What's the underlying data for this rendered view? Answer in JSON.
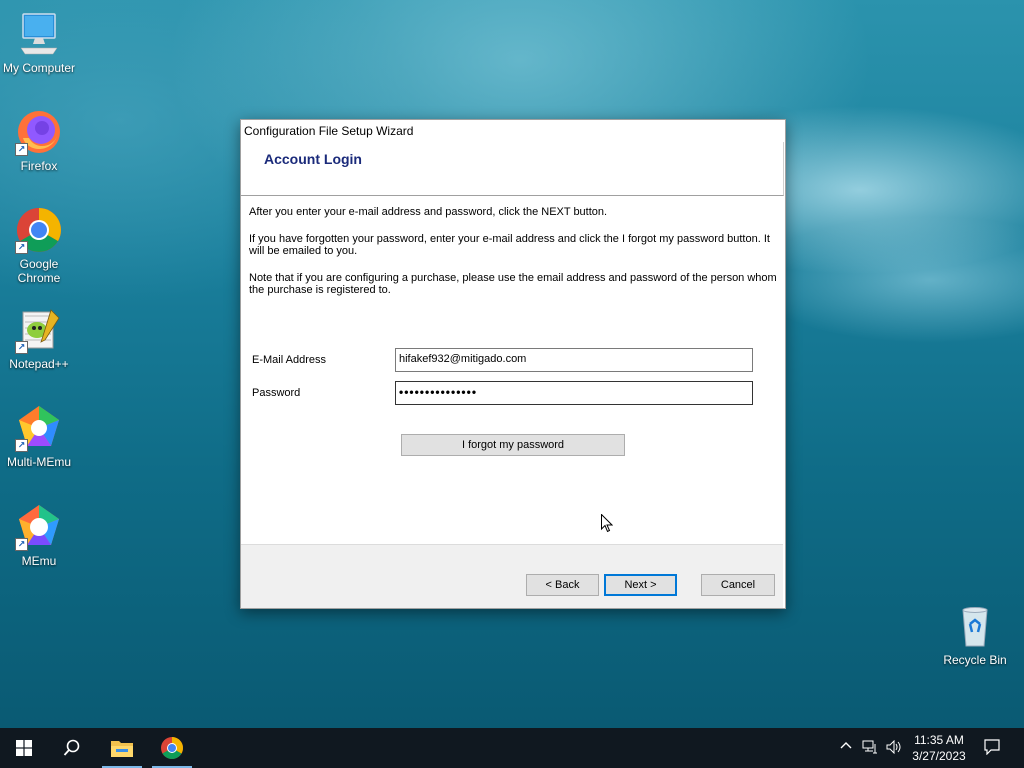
{
  "desktop": {
    "icons": [
      {
        "label": "My Computer"
      },
      {
        "label": "Firefox"
      },
      {
        "label": "Google Chrome"
      },
      {
        "label": "Notepad++"
      },
      {
        "label": "Multi-MEmu"
      },
      {
        "label": "MEmu"
      },
      {
        "label": "Recycle Bin"
      }
    ]
  },
  "dialog": {
    "title": "Configuration File Setup Wizard",
    "header": "Account Login",
    "paragraphs": [
      "After you enter your e-mail address and password, click the NEXT button.",
      "If you have forgotten your password, enter your e-mail address and click the I forgot my password button. It will be emailed to you.",
      "Note that if you are configuring a purchase, please use the email address and password of the person whom the purchase is registered to."
    ],
    "email_label": "E-Mail Address",
    "email_value": "hifakef932@mitigado.com",
    "password_label": "Password",
    "password_value": "•••••••••••••••",
    "forgot_button": "I forgot my password",
    "back_button": "< Back",
    "next_button": "Next >",
    "cancel_button": "Cancel"
  },
  "taskbar": {
    "time": "11:35 AM",
    "date": "3/27/2023",
    "pinned": [
      "file-explorer-icon",
      "chrome-icon"
    ]
  }
}
